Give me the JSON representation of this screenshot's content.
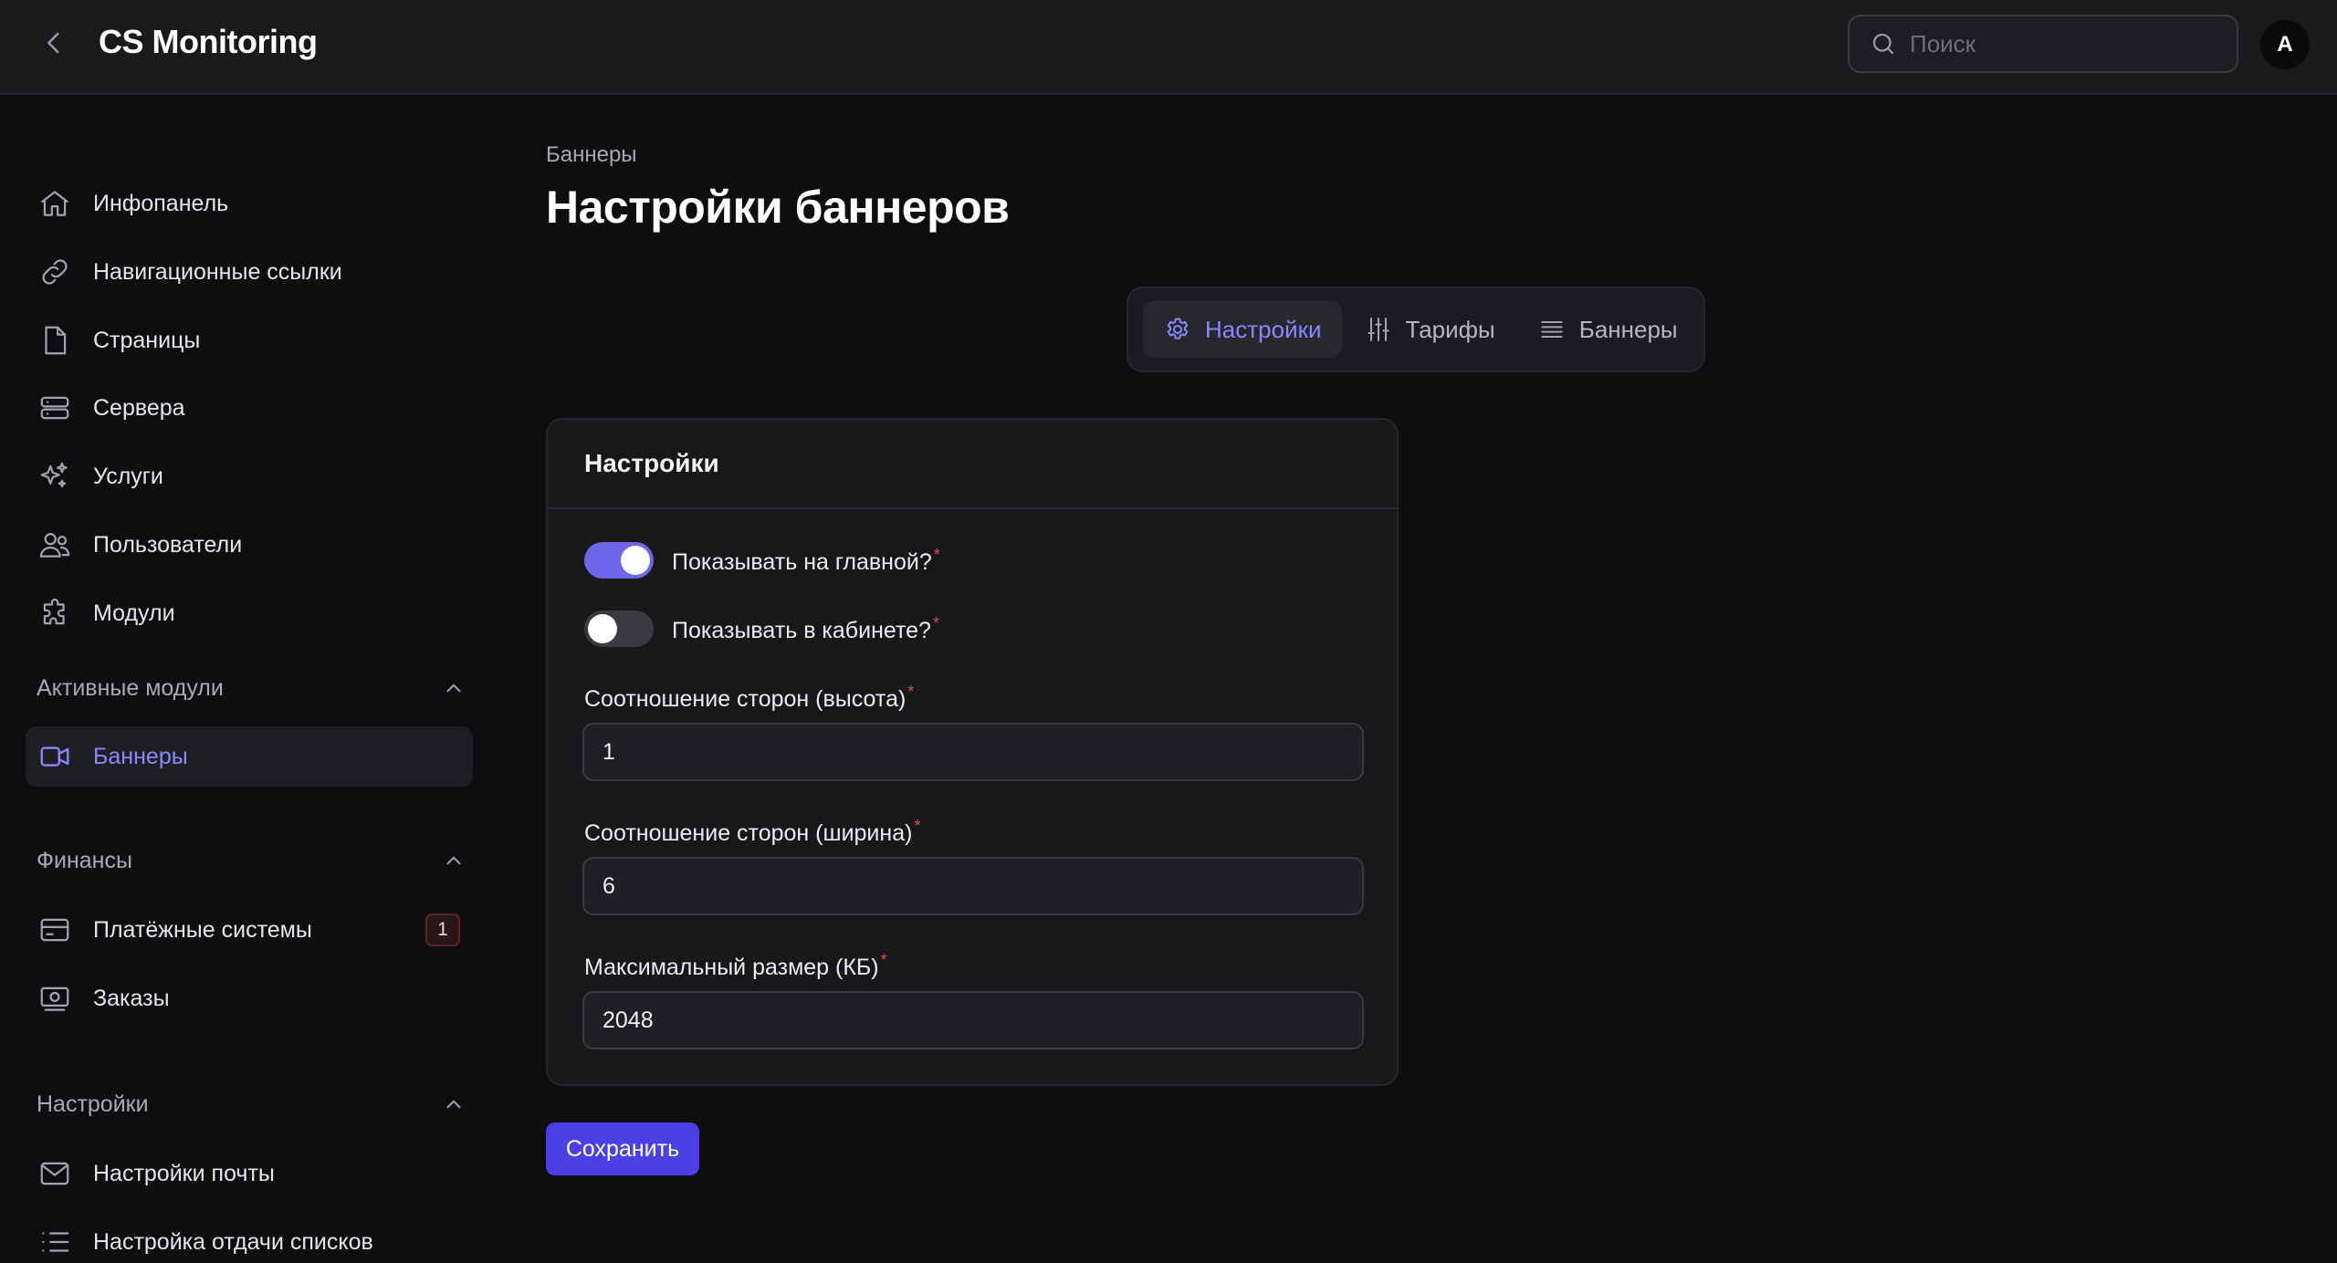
{
  "header": {
    "app_title": "CS Monitoring",
    "search_placeholder": "Поиск",
    "avatar_initial": "A"
  },
  "sidebar": {
    "items": [
      {
        "label": "Инфопанель",
        "icon": "home-icon"
      },
      {
        "label": "Навигационные ссылки",
        "icon": "link-icon"
      },
      {
        "label": "Страницы",
        "icon": "document-icon"
      },
      {
        "label": "Сервера",
        "icon": "server-icon"
      },
      {
        "label": "Услуги",
        "icon": "sparkles-icon"
      },
      {
        "label": "Пользователи",
        "icon": "users-icon"
      },
      {
        "label": "Модули",
        "icon": "puzzle-icon"
      }
    ],
    "groups": [
      {
        "title": "Активные модули",
        "items": [
          {
            "label": "Баннеры",
            "icon": "video-icon",
            "active": true
          }
        ]
      },
      {
        "title": "Финансы",
        "items": [
          {
            "label": "Платёжные системы",
            "icon": "credit-card-icon",
            "badge": "1"
          },
          {
            "label": "Заказы",
            "icon": "cash-icon"
          }
        ]
      },
      {
        "title": "Настройки",
        "items": [
          {
            "label": "Настройки почты",
            "icon": "envelope-icon"
          },
          {
            "label": "Настройка отдачи списков",
            "icon": "list-icon"
          }
        ]
      }
    ]
  },
  "main": {
    "breadcrumb": "Баннеры",
    "page_title": "Настройки баннеров",
    "tabs": [
      {
        "label": "Настройки",
        "icon": "gear-icon",
        "active": true
      },
      {
        "label": "Тарифы",
        "icon": "sliders-icon"
      },
      {
        "label": "Баннеры",
        "icon": "stack-icon"
      }
    ],
    "card": {
      "title": "Настройки",
      "toggles": [
        {
          "label": "Показывать на главной?",
          "required": "*",
          "on": true
        },
        {
          "label": "Показывать в кабинете?",
          "required": "*",
          "on": false
        }
      ],
      "fields": [
        {
          "label": "Соотношение сторон (высота)",
          "required": "*",
          "value": "1"
        },
        {
          "label": "Соотношение сторон (ширина)",
          "required": "*",
          "value": "6"
        },
        {
          "label": "Максимальный размер (КБ)",
          "required": "*",
          "value": "2048"
        }
      ]
    },
    "save_label": "Сохранить"
  },
  "colors": {
    "accent": "#8b88ff",
    "primary_button": "#4b3fe6",
    "toggle_on": "#6b67e8",
    "required_mark": "#e5484d",
    "background": "#0e0e10"
  }
}
